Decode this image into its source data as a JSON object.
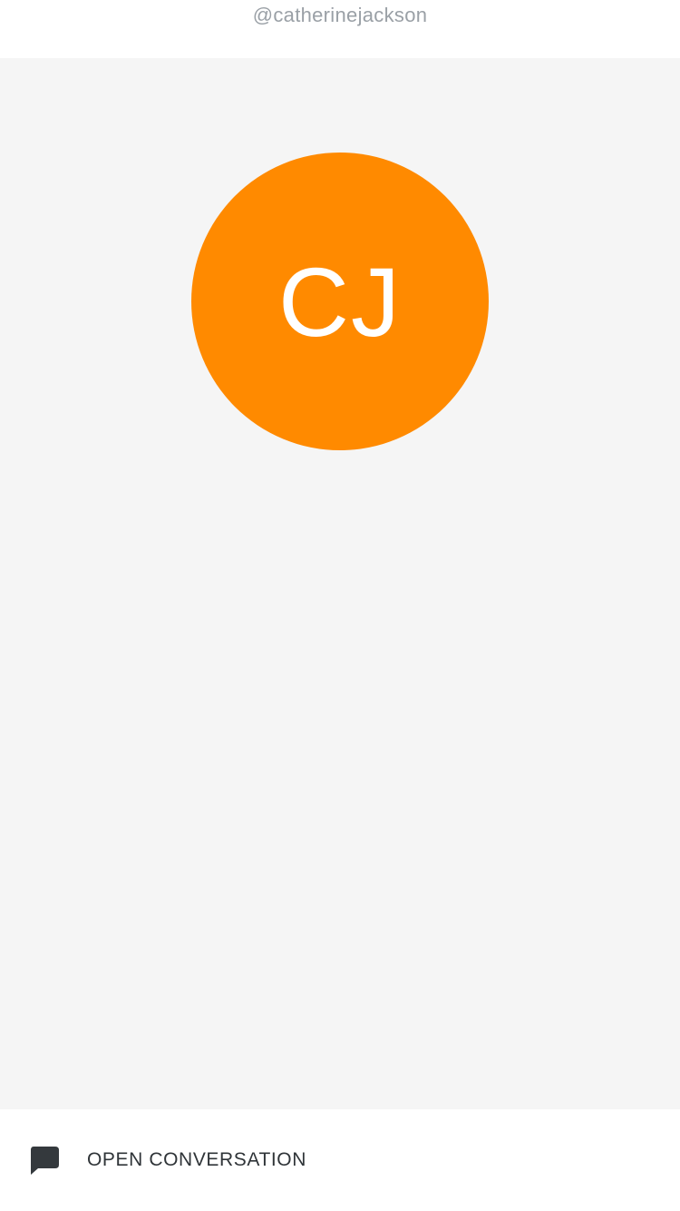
{
  "profile": {
    "username": "@catherinejackson",
    "initials": "CJ",
    "avatar_color": "#ff8a00"
  },
  "footer": {
    "open_label": "OPEN CONVERSATION",
    "icon": "chat-bubble-icon"
  }
}
